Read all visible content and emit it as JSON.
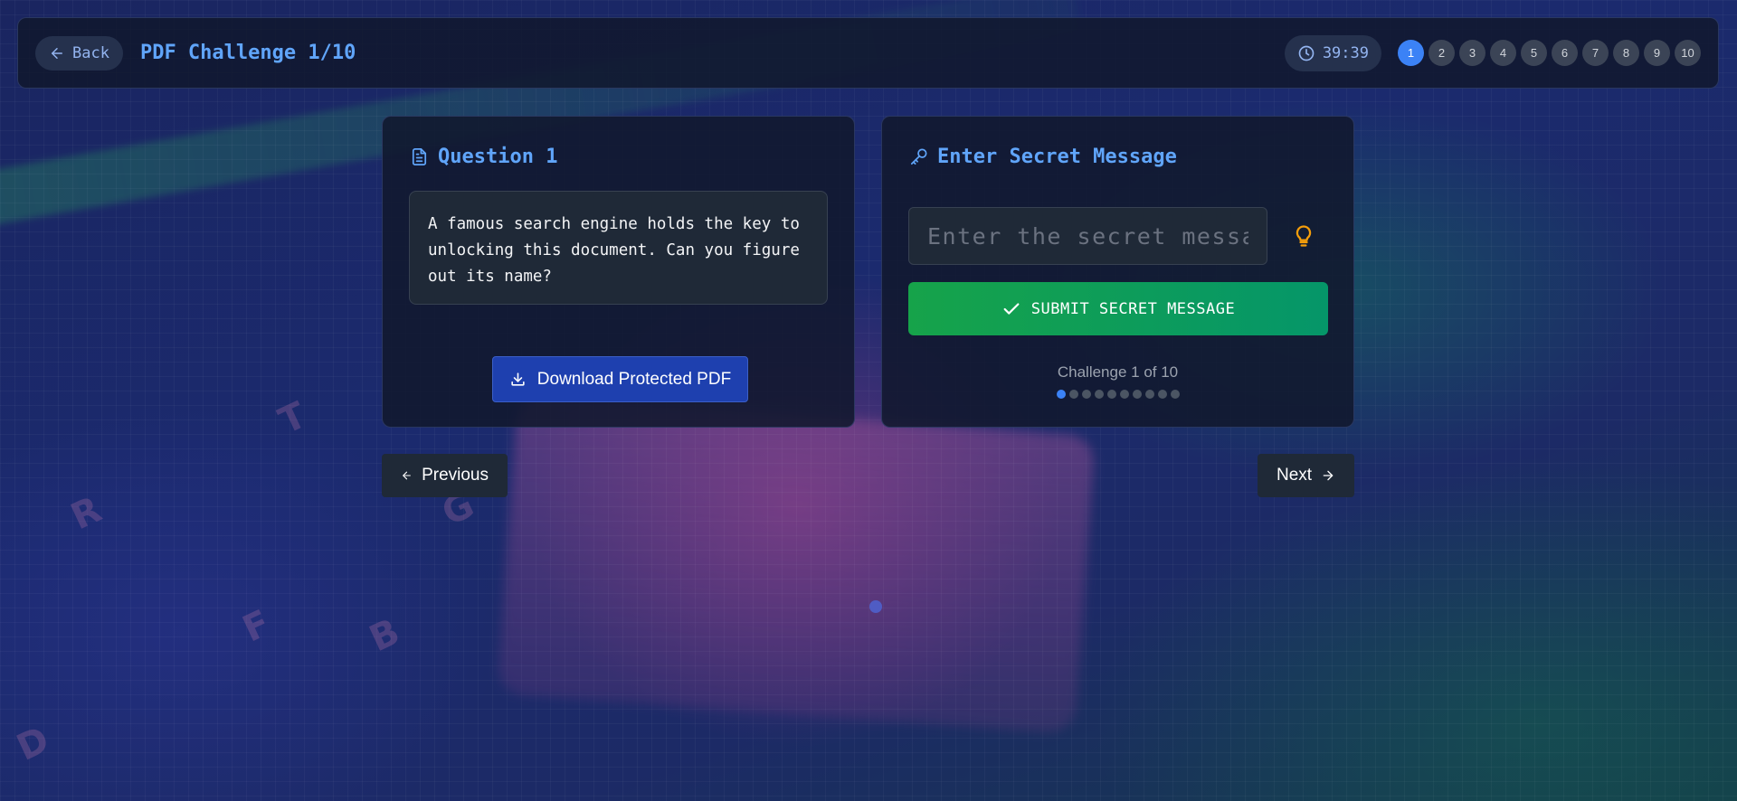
{
  "header": {
    "back_label": "Back",
    "title": "PDF Challenge 1/10",
    "timer": "39:39",
    "steps": [
      "1",
      "2",
      "3",
      "4",
      "5",
      "6",
      "7",
      "8",
      "9",
      "10"
    ],
    "active_step": "1"
  },
  "question_card": {
    "title": "Question 1",
    "icon": "document-icon",
    "text": "A famous search engine holds the key to unlocking this document. Can you figure out its name?",
    "download_label": "Download Protected PDF"
  },
  "secret_card": {
    "title": "Enter Secret Message",
    "icon": "key-icon",
    "input_placeholder": "Enter the secret message",
    "input_value": "",
    "hint_icon": "lightbulb-icon",
    "submit_label": "SUBMIT SECRET MESSAGE",
    "progress_label": "Challenge 1 of 10",
    "progress_total": 10,
    "progress_current": 1
  },
  "navigation": {
    "previous_label": "Previous",
    "next_label": "Next"
  },
  "colors": {
    "accent": "#60a5fa",
    "active_step": "#3b82f6",
    "submit_start": "#16a34a",
    "submit_end": "#059669",
    "download": "#1e40af",
    "hint": "#f59e0b"
  }
}
